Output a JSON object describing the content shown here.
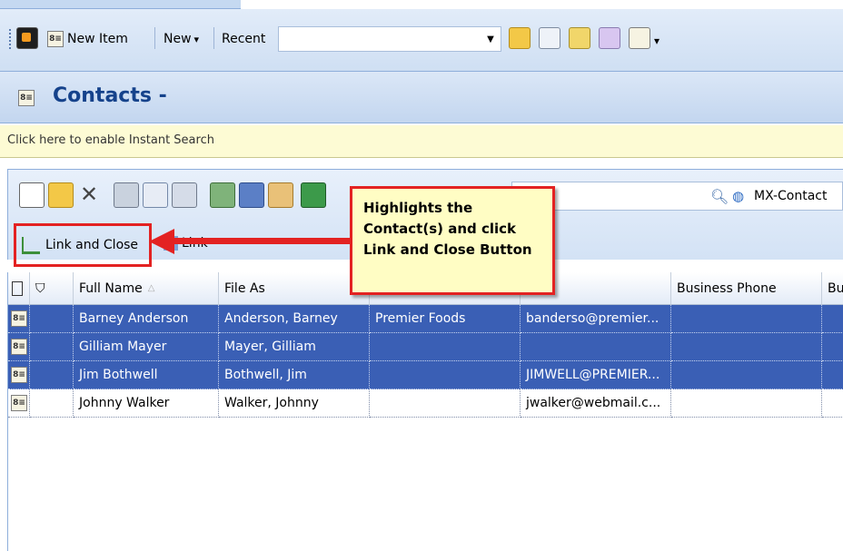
{
  "toolbar": {
    "new_item_label": "New Item",
    "new_label": "New",
    "new_dropdown_glyph": "▾",
    "recent_label": "Recent",
    "recent_value": ""
  },
  "header": {
    "title": "Contacts -"
  },
  "search": {
    "instant_search_text": "Click here to enable Instant Search"
  },
  "inner_toolbar": {
    "folder_combo_value": "MX-Contact"
  },
  "actions": {
    "link_close_label": "Link and Close",
    "link_label": "Link"
  },
  "callout": {
    "lines": [
      "Highlights the",
      "Contact(s) and click",
      "Link and Close Button"
    ]
  },
  "table": {
    "columns": [
      "Full Name",
      "File As",
      "",
      "",
      "Business Phone",
      "Bu"
    ],
    "rows": [
      {
        "full_name": "Barney Anderson",
        "file_as": "Anderson, Barney",
        "company": "Premier Foods",
        "email": "banderso@premier...",
        "phone": "",
        "selected": true
      },
      {
        "full_name": "Gilliam Mayer",
        "file_as": "Mayer, Gilliam",
        "company": "",
        "email": "",
        "phone": "",
        "selected": true
      },
      {
        "full_name": "Jim Bothwell",
        "file_as": "Bothwell, Jim",
        "company": "",
        "email": "JIMWELL@PREMIER...",
        "phone": "",
        "selected": true
      },
      {
        "full_name": "Johnny Walker",
        "file_as": "Walker, Johnny",
        "company": "",
        "email": "jwalker@webmail.c...",
        "phone": "",
        "selected": false
      }
    ]
  },
  "colors": {
    "selection": "#3a5fb5",
    "callout_border": "#e32222",
    "callout_bg": "#fffdc4",
    "title": "#15428b"
  }
}
